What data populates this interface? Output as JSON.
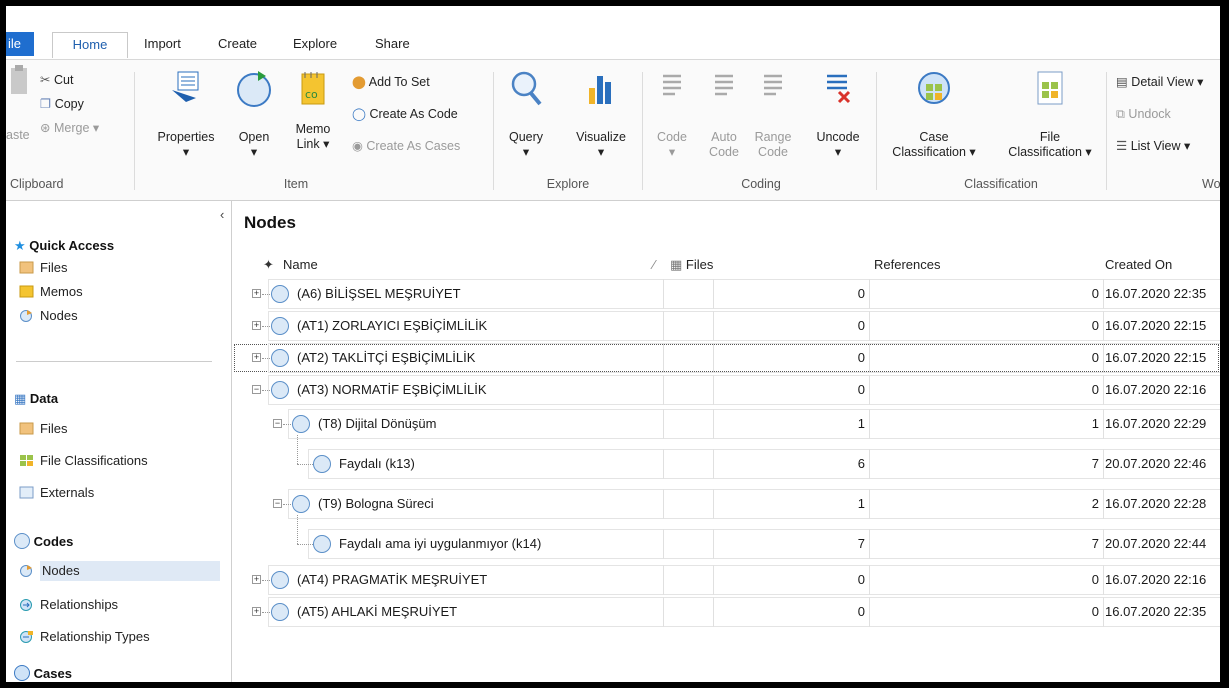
{
  "ribbon_tabs": [
    "ile",
    "Home",
    "Import",
    "Create",
    "Explore",
    "Share"
  ],
  "clipboard": {
    "paste": "aste",
    "cut": "Cut",
    "copy": "Copy",
    "merge": "Merge",
    "group": "Clipboard"
  },
  "item": {
    "properties": "Properties",
    "open": "Open",
    "memo": "Memo",
    "link": "Link",
    "add_to_set": "Add To Set",
    "create_as_code": "Create As Code",
    "create_as_cases": "Create As Cases",
    "group": "Item"
  },
  "explore": {
    "query": "Query",
    "visualize": "Visualize",
    "group": "Explore"
  },
  "coding": {
    "code": "Code",
    "auto": "Auto",
    "auto2": "Code",
    "range": "Range",
    "range2": "Code",
    "uncode": "Uncode",
    "group": "Coding"
  },
  "classification": {
    "case1": "Case",
    "case2": "Classification",
    "file1": "File",
    "file2": "Classification",
    "group": "Classification"
  },
  "workspace": {
    "detail_view": "Detail View",
    "undock": "Undock",
    "list_view": "List View",
    "group_partial": "Wo"
  },
  "nav": {
    "quick_access": "Quick Access",
    "qa_items": [
      "Files",
      "Memos",
      "Nodes"
    ],
    "data": "Data",
    "data_items": [
      "Files",
      "File Classifications",
      "Externals"
    ],
    "codes": "Codes",
    "codes_items": [
      "Nodes",
      "Relationships",
      "Relationship Types"
    ],
    "cases": "Cases"
  },
  "main": {
    "title": "Nodes",
    "columns": {
      "name": "Name",
      "files": "Files",
      "references": "References",
      "created_on": "Created On"
    },
    "rows": [
      {
        "name": "(A6) BİLİŞSEL MEŞRUİYET",
        "files": "0",
        "refs": "0",
        "created": "16.07.2020 22:35"
      },
      {
        "name": "(AT1) ZORLAYICI EŞBİÇİMLİLİK",
        "files": "0",
        "refs": "0",
        "created": "16.07.2020 22:15"
      },
      {
        "name": "(AT2) TAKLİTÇİ EŞBİÇİMLİLİK",
        "files": "0",
        "refs": "0",
        "created": "16.07.2020 22:15"
      },
      {
        "name": "(AT3) NORMATİF EŞBİÇİMLİLİK",
        "files": "0",
        "refs": "0",
        "created": "16.07.2020 22:16"
      },
      {
        "name": "(T8) Dijital Dönüşüm",
        "files": "1",
        "refs": "1",
        "created": "16.07.2020 22:29"
      },
      {
        "name": "Faydalı (k13)",
        "files": "6",
        "refs": "7",
        "created": "20.07.2020 22:46"
      },
      {
        "name": "(T9) Bologna Süreci",
        "files": "1",
        "refs": "2",
        "created": "16.07.2020 22:28"
      },
      {
        "name": "Faydalı ama iyi uygulanmıyor (k14)",
        "files": "7",
        "refs": "7",
        "created": "20.07.2020 22:44"
      },
      {
        "name": "(AT4) PRAGMATİK MEŞRUİYET",
        "files": "0",
        "refs": "0",
        "created": "16.07.2020 22:16"
      },
      {
        "name": "(AT5) AHLAKİ MEŞRUİYET",
        "files": "0",
        "refs": "0",
        "created": "16.07.2020 22:35"
      }
    ]
  },
  "colors": {
    "accent": "#1f6ecf",
    "node_fill": "#dbe9f7",
    "node_stroke": "#5b8fc8"
  }
}
